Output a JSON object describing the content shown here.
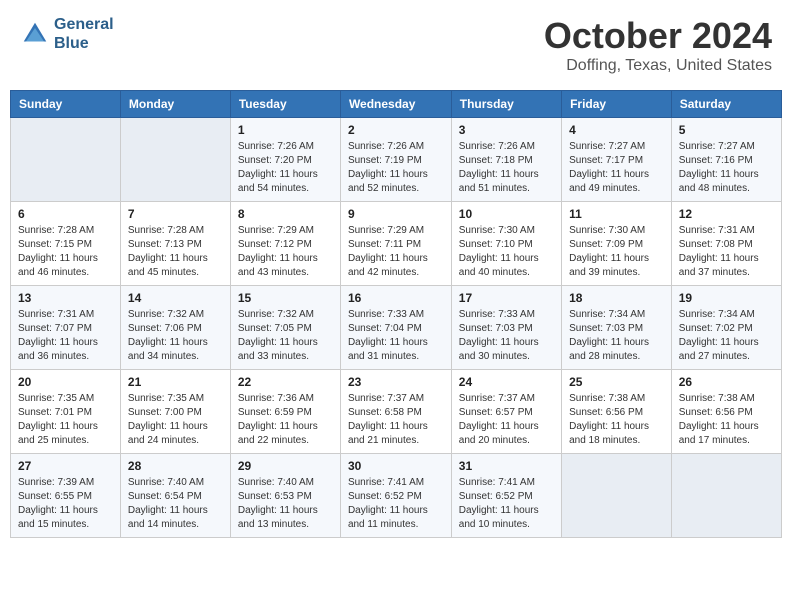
{
  "header": {
    "logo_line1": "General",
    "logo_line2": "Blue",
    "month": "October 2024",
    "location": "Doffing, Texas, United States"
  },
  "days_of_week": [
    "Sunday",
    "Monday",
    "Tuesday",
    "Wednesday",
    "Thursday",
    "Friday",
    "Saturday"
  ],
  "weeks": [
    [
      {
        "day": "",
        "info": ""
      },
      {
        "day": "",
        "info": ""
      },
      {
        "day": "1",
        "info": "Sunrise: 7:26 AM\nSunset: 7:20 PM\nDaylight: 11 hours and 54 minutes."
      },
      {
        "day": "2",
        "info": "Sunrise: 7:26 AM\nSunset: 7:19 PM\nDaylight: 11 hours and 52 minutes."
      },
      {
        "day": "3",
        "info": "Sunrise: 7:26 AM\nSunset: 7:18 PM\nDaylight: 11 hours and 51 minutes."
      },
      {
        "day": "4",
        "info": "Sunrise: 7:27 AM\nSunset: 7:17 PM\nDaylight: 11 hours and 49 minutes."
      },
      {
        "day": "5",
        "info": "Sunrise: 7:27 AM\nSunset: 7:16 PM\nDaylight: 11 hours and 48 minutes."
      }
    ],
    [
      {
        "day": "6",
        "info": "Sunrise: 7:28 AM\nSunset: 7:15 PM\nDaylight: 11 hours and 46 minutes."
      },
      {
        "day": "7",
        "info": "Sunrise: 7:28 AM\nSunset: 7:13 PM\nDaylight: 11 hours and 45 minutes."
      },
      {
        "day": "8",
        "info": "Sunrise: 7:29 AM\nSunset: 7:12 PM\nDaylight: 11 hours and 43 minutes."
      },
      {
        "day": "9",
        "info": "Sunrise: 7:29 AM\nSunset: 7:11 PM\nDaylight: 11 hours and 42 minutes."
      },
      {
        "day": "10",
        "info": "Sunrise: 7:30 AM\nSunset: 7:10 PM\nDaylight: 11 hours and 40 minutes."
      },
      {
        "day": "11",
        "info": "Sunrise: 7:30 AM\nSunset: 7:09 PM\nDaylight: 11 hours and 39 minutes."
      },
      {
        "day": "12",
        "info": "Sunrise: 7:31 AM\nSunset: 7:08 PM\nDaylight: 11 hours and 37 minutes."
      }
    ],
    [
      {
        "day": "13",
        "info": "Sunrise: 7:31 AM\nSunset: 7:07 PM\nDaylight: 11 hours and 36 minutes."
      },
      {
        "day": "14",
        "info": "Sunrise: 7:32 AM\nSunset: 7:06 PM\nDaylight: 11 hours and 34 minutes."
      },
      {
        "day": "15",
        "info": "Sunrise: 7:32 AM\nSunset: 7:05 PM\nDaylight: 11 hours and 33 minutes."
      },
      {
        "day": "16",
        "info": "Sunrise: 7:33 AM\nSunset: 7:04 PM\nDaylight: 11 hours and 31 minutes."
      },
      {
        "day": "17",
        "info": "Sunrise: 7:33 AM\nSunset: 7:03 PM\nDaylight: 11 hours and 30 minutes."
      },
      {
        "day": "18",
        "info": "Sunrise: 7:34 AM\nSunset: 7:03 PM\nDaylight: 11 hours and 28 minutes."
      },
      {
        "day": "19",
        "info": "Sunrise: 7:34 AM\nSunset: 7:02 PM\nDaylight: 11 hours and 27 minutes."
      }
    ],
    [
      {
        "day": "20",
        "info": "Sunrise: 7:35 AM\nSunset: 7:01 PM\nDaylight: 11 hours and 25 minutes."
      },
      {
        "day": "21",
        "info": "Sunrise: 7:35 AM\nSunset: 7:00 PM\nDaylight: 11 hours and 24 minutes."
      },
      {
        "day": "22",
        "info": "Sunrise: 7:36 AM\nSunset: 6:59 PM\nDaylight: 11 hours and 22 minutes."
      },
      {
        "day": "23",
        "info": "Sunrise: 7:37 AM\nSunset: 6:58 PM\nDaylight: 11 hours and 21 minutes."
      },
      {
        "day": "24",
        "info": "Sunrise: 7:37 AM\nSunset: 6:57 PM\nDaylight: 11 hours and 20 minutes."
      },
      {
        "day": "25",
        "info": "Sunrise: 7:38 AM\nSunset: 6:56 PM\nDaylight: 11 hours and 18 minutes."
      },
      {
        "day": "26",
        "info": "Sunrise: 7:38 AM\nSunset: 6:56 PM\nDaylight: 11 hours and 17 minutes."
      }
    ],
    [
      {
        "day": "27",
        "info": "Sunrise: 7:39 AM\nSunset: 6:55 PM\nDaylight: 11 hours and 15 minutes."
      },
      {
        "day": "28",
        "info": "Sunrise: 7:40 AM\nSunset: 6:54 PM\nDaylight: 11 hours and 14 minutes."
      },
      {
        "day": "29",
        "info": "Sunrise: 7:40 AM\nSunset: 6:53 PM\nDaylight: 11 hours and 13 minutes."
      },
      {
        "day": "30",
        "info": "Sunrise: 7:41 AM\nSunset: 6:52 PM\nDaylight: 11 hours and 11 minutes."
      },
      {
        "day": "31",
        "info": "Sunrise: 7:41 AM\nSunset: 6:52 PM\nDaylight: 11 hours and 10 minutes."
      },
      {
        "day": "",
        "info": ""
      },
      {
        "day": "",
        "info": ""
      }
    ]
  ]
}
